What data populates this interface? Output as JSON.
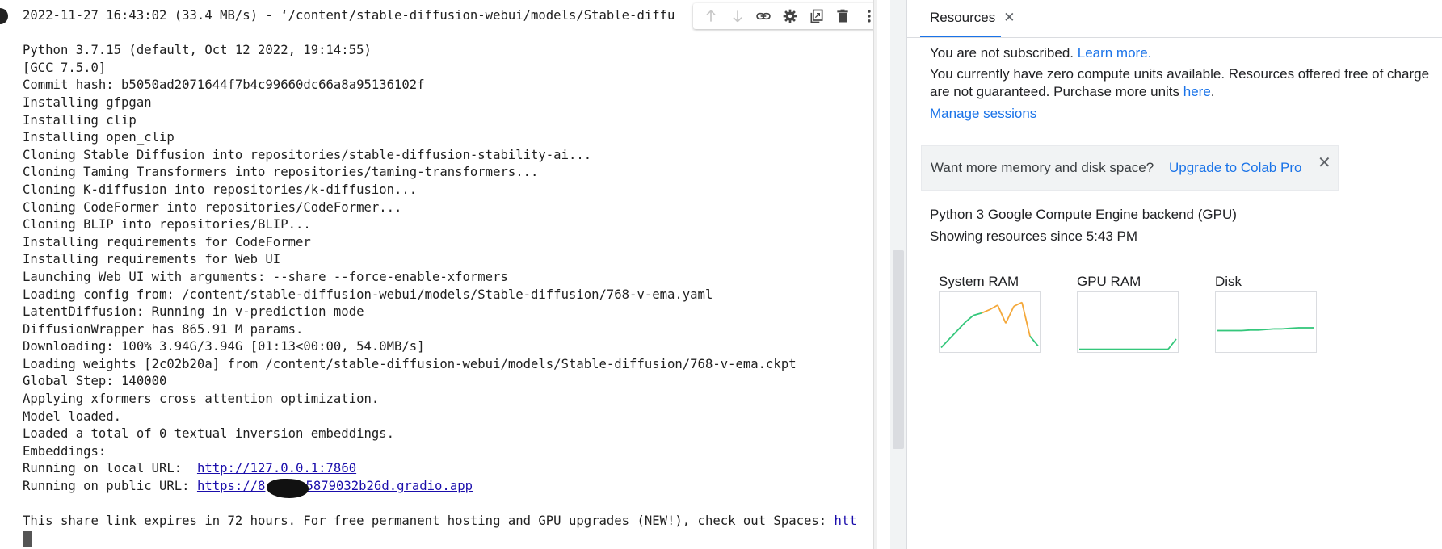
{
  "output": {
    "lines": [
      {
        "text": "2022-11-27 16:43:02 (33.4 MB/s) - ‘/content/stable-diffusion-webui/models/Stable-diffu"
      },
      {
        "text": ""
      },
      {
        "text": "Python 3.7.15 (default, Oct 12 2022, 19:14:55)"
      },
      {
        "text": "[GCC 7.5.0]"
      },
      {
        "text": "Commit hash: b5050ad2071644f7b4c99660dc66a8a95136102f"
      },
      {
        "text": "Installing gfpgan"
      },
      {
        "text": "Installing clip"
      },
      {
        "text": "Installing open_clip"
      },
      {
        "text": "Cloning Stable Diffusion into repositories/stable-diffusion-stability-ai..."
      },
      {
        "text": "Cloning Taming Transformers into repositories/taming-transformers..."
      },
      {
        "text": "Cloning K-diffusion into repositories/k-diffusion..."
      },
      {
        "text": "Cloning CodeFormer into repositories/CodeFormer..."
      },
      {
        "text": "Cloning BLIP into repositories/BLIP..."
      },
      {
        "text": "Installing requirements for CodeFormer"
      },
      {
        "text": "Installing requirements for Web UI"
      },
      {
        "text": "Launching Web UI with arguments: --share --force-enable-xformers"
      },
      {
        "text": "Loading config from: /content/stable-diffusion-webui/models/Stable-diffusion/768-v-ema.yaml"
      },
      {
        "text": "LatentDiffusion: Running in v-prediction mode"
      },
      {
        "text": "DiffusionWrapper has 865.91 M params."
      },
      {
        "text": "Downloading: 100% 3.94G/3.94G [01:13<00:00, 54.0MB/s]"
      },
      {
        "text": "Loading weights [2c02b20a] from /content/stable-diffusion-webui/models/Stable-diffusion/768-v-ema.ckpt"
      },
      {
        "text": "Global Step: 140000"
      },
      {
        "text": "Applying xformers cross attention optimization."
      },
      {
        "text": "Model loaded."
      },
      {
        "text": "Loaded a total of 0 textual inversion embeddings."
      },
      {
        "text": "Embeddings:"
      }
    ],
    "local_url_prefix": "Running on local URL:  ",
    "local_url": "http://127.0.0.1:7860",
    "public_url_prefix": "Running on public URL: ",
    "public_url": "https://8",
    "public_url_tail": "5879032b26d.gradio.app",
    "share_notice": "This share link expires in 72 hours. For free permanent hosting and GPU upgrades (NEW!), check out Spaces: ",
    "share_notice_link": "htt"
  },
  "toolbar": {
    "icons": [
      "arrow-up-icon",
      "arrow-down-icon",
      "link-icon",
      "gear-icon",
      "mirror-cell-icon",
      "trash-icon",
      "more-vert-icon"
    ]
  },
  "resources": {
    "tab_label": "Resources",
    "tab_close": "✕",
    "not_subscribed": "You are not subscribed.",
    "learn_more": "Learn more.",
    "zero_units_line1": "You currently have zero compute units available. Resources offered free of charge",
    "zero_units_line2_prefix": "are not guaranteed. Purchase more units ",
    "here_link": "here",
    "period": ".",
    "manage_sessions": "Manage sessions",
    "upgrade_prompt": "Want more memory and disk space?",
    "upgrade_link": "Upgrade to Colab Pro",
    "upgrade_close": "✕",
    "backend": "Python 3 Google Compute Engine backend (GPU)",
    "since": "Showing resources since 5:43 PM",
    "accent_color": "#1a73e8"
  },
  "chart_data": [
    {
      "type": "line",
      "title": "System RAM",
      "x": [
        0,
        1,
        2,
        3,
        4,
        5,
        6,
        7,
        8,
        9,
        10,
        11,
        12
      ],
      "series": [
        {
          "values": [
            0.05,
            0.2,
            0.35,
            0.5,
            0.62,
            0.66,
            0.72,
            0.8,
            0.48,
            0.78,
            0.85,
            0.25,
            0.08
          ],
          "color_segments": "green then orange"
        }
      ],
      "ylim": [
        0,
        1
      ],
      "grid": false
    },
    {
      "type": "line",
      "title": "GPU RAM",
      "x": [
        0,
        1,
        2,
        3,
        4,
        5,
        6,
        7,
        8,
        9,
        10,
        11,
        12
      ],
      "series": [
        {
          "values": [
            0.02,
            0.02,
            0.02,
            0.02,
            0.02,
            0.02,
            0.02,
            0.02,
            0.02,
            0.02,
            0.02,
            0.02,
            0.2
          ]
        }
      ],
      "ylim": [
        0,
        1
      ],
      "grid": false
    },
    {
      "type": "line",
      "title": "Disk",
      "x": [
        0,
        1,
        2,
        3,
        4,
        5,
        6,
        7,
        8,
        9,
        10,
        11,
        12
      ],
      "series": [
        {
          "values": [
            0.35,
            0.35,
            0.35,
            0.35,
            0.36,
            0.36,
            0.37,
            0.38,
            0.38,
            0.39,
            0.4,
            0.4,
            0.4
          ]
        }
      ],
      "ylim": [
        0,
        1
      ],
      "grid": false
    }
  ]
}
